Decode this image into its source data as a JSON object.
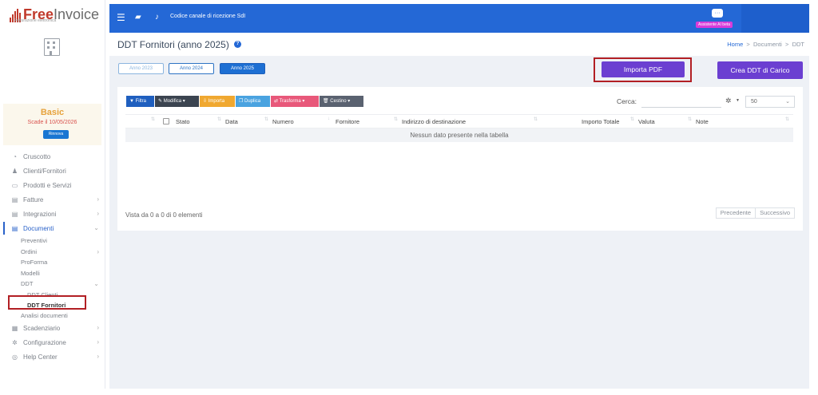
{
  "brand": {
    "name_part1": "Free",
    "name_part2": "Invoice",
    "tagline": "Fatturazione elettronica"
  },
  "plan": {
    "name": "Basic",
    "expiry": "Scade il 10/05/2026",
    "renew_label": "Rinnova"
  },
  "sidebar": {
    "items": [
      {
        "label": "Cruscotto",
        "icon": "dashboard-icon"
      },
      {
        "label": "Clienti/Fornitori",
        "icon": "user-icon"
      },
      {
        "label": "Prodotti e Servizi",
        "icon": "basket-icon"
      },
      {
        "label": "Fatture",
        "icon": "document-icon"
      },
      {
        "label": "Integrazioni",
        "icon": "document-icon"
      },
      {
        "label": "Documenti",
        "icon": "documents-icon"
      }
    ],
    "documenti_sub": [
      "Preventivi",
      "Ordini",
      "ProForma",
      "Modelli",
      "DDT"
    ],
    "ddt_sub": [
      "DDT Clienti",
      "DDT Fornitori",
      "Analisi documenti"
    ],
    "bottom": [
      {
        "label": "Scadenziario",
        "icon": "calendar-icon"
      },
      {
        "label": "Configurazione",
        "icon": "gear-icon"
      },
      {
        "label": "Help Center",
        "icon": "lifebuoy-icon"
      }
    ]
  },
  "topbar": {
    "channel_text": "Codice canale di ricezione SdI",
    "assistant_label": "Assistente AI beta"
  },
  "page": {
    "title": "DDT Fornitori (anno 2025)",
    "breadcrumb": {
      "home": "Home",
      "sep": ">",
      "section": "Documenti",
      "current": "DDT"
    }
  },
  "years": [
    "Anno 2023",
    "Anno 2024",
    "Anno 2025"
  ],
  "actions": {
    "import_pdf": "Importa PDF",
    "create_ddt": "Crea DDT di Carico"
  },
  "toolbar": {
    "filter": "Filtra",
    "edit": "Modifica",
    "export": "Importa",
    "duplicate": "Duplica",
    "transform": "Trasforma",
    "trash": "Cestino",
    "search_label": "Cerca:",
    "page_size": "50"
  },
  "table": {
    "columns": [
      "Stato",
      "Data",
      "Numero",
      "Fornitore",
      "Indirizzo di destinazione",
      "Importo Totale",
      "Valuta",
      "Note"
    ],
    "empty_message": "Nessun dato presente nella tabella",
    "info": "Vista da 0 a 0 di 0 elementi",
    "prev": "Precedente",
    "next": "Successivo"
  },
  "colors": {
    "primary": "#2468d6",
    "import_button": "#6b3fd1",
    "highlight": "#b21f24",
    "plan": "#e6a23c"
  }
}
